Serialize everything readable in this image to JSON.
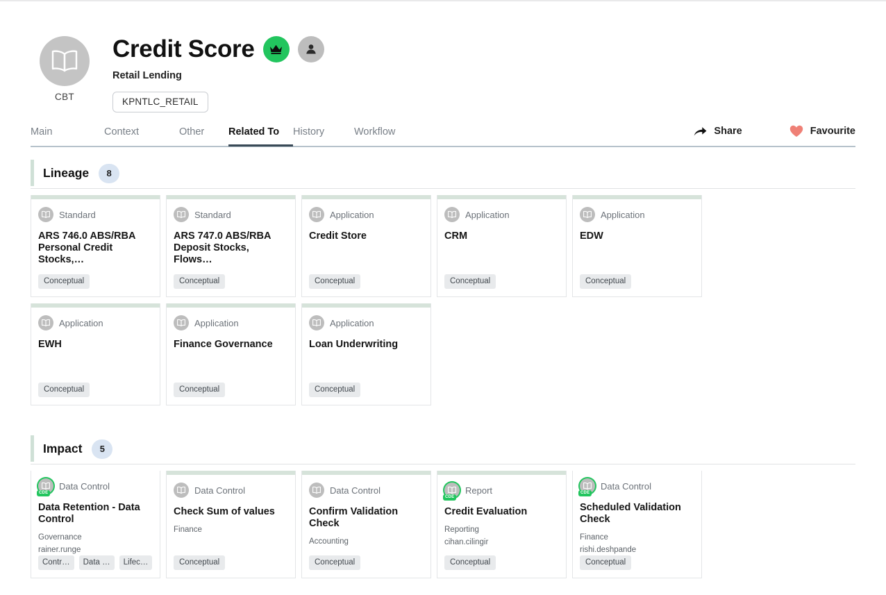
{
  "header": {
    "entity_code": "CBT",
    "entity_icon": "open-book-icon",
    "title": "Credit Score",
    "subtitle": "Retail Lending",
    "tag": "KPNTLC_RETAIL",
    "crown_badge_icon": "crown-icon",
    "crown_badge_color": "#22c55e",
    "user_badge_icon": "person-icon",
    "user_badge_color": "#bdbdbd"
  },
  "tabs": [
    {
      "label": "Main",
      "active": false
    },
    {
      "label": "Context",
      "active": false
    },
    {
      "label": "Other",
      "active": false
    },
    {
      "label": "Related To",
      "active": true
    },
    {
      "label": "History",
      "active": false
    },
    {
      "label": "Workflow",
      "active": false
    }
  ],
  "actions": [
    {
      "label": "Share",
      "icon": "share-arrow-icon",
      "color": "#1d1d1d"
    },
    {
      "label": "Favourite",
      "icon": "heart-icon",
      "color": "#ef8076"
    }
  ],
  "sections": [
    {
      "title": "Lineage",
      "count": "8",
      "accent_color": "#cfe0d6",
      "cards": [
        {
          "type": "Standard",
          "name": "ARS 746.0 ABS/RBA Personal Credit Stocks,…",
          "meta1": "",
          "meta2": "",
          "chips": [
            "Conceptual"
          ],
          "cde": false
        },
        {
          "type": "Standard",
          "name": "ARS 747.0 ABS/RBA Deposit Stocks, Flows…",
          "meta1": "",
          "meta2": "",
          "chips": [
            "Conceptual"
          ],
          "cde": false
        },
        {
          "type": "Application",
          "name": "Credit Store",
          "meta1": "",
          "meta2": "",
          "chips": [
            "Conceptual"
          ],
          "cde": false
        },
        {
          "type": "Application",
          "name": "CRM",
          "meta1": "",
          "meta2": "",
          "chips": [
            "Conceptual"
          ],
          "cde": false
        },
        {
          "type": "Application",
          "name": "EDW",
          "meta1": "",
          "meta2": "",
          "chips": [
            "Conceptual"
          ],
          "cde": false
        },
        {
          "type": "Application",
          "name": "EWH",
          "meta1": "",
          "meta2": "",
          "chips": [
            "Conceptual"
          ],
          "cde": false
        },
        {
          "type": "Application",
          "name": "Finance Governance",
          "meta1": "",
          "meta2": "",
          "chips": [
            "Conceptual"
          ],
          "cde": false
        },
        {
          "type": "Application",
          "name": "Loan Underwriting",
          "meta1": "",
          "meta2": "",
          "chips": [
            "Conceptual"
          ],
          "cde": false
        }
      ]
    },
    {
      "title": "Impact",
      "count": "5",
      "accent_color": "#cfe0d6",
      "cards": [
        {
          "type": "Data Control",
          "name": "Data Retention - Data Control",
          "meta1": "Governance",
          "meta2": "rainer.runge",
          "chips": [
            "Contr…",
            "Data …",
            "Lifec…"
          ],
          "cde": true
        },
        {
          "type": "Data Control",
          "name": "Check Sum of values",
          "meta1": "Finance",
          "meta2": "",
          "chips": [
            "Conceptual"
          ],
          "cde": false
        },
        {
          "type": "Data Control",
          "name": "Confirm Validation Check",
          "meta1": "Accounting",
          "meta2": "",
          "chips": [
            "Conceptual"
          ],
          "cde": false
        },
        {
          "type": "Report",
          "name": "Credit Evaluation",
          "meta1": "Reporting",
          "meta2": "cihan.cilingir",
          "chips": [
            "Conceptual"
          ],
          "cde": true
        },
        {
          "type": "Data Control",
          "name": "Scheduled Validation Check",
          "meta1": "Finance",
          "meta2": "rishi.deshpande",
          "chips": [
            "Conceptual"
          ],
          "cde": true
        }
      ]
    }
  ],
  "cde_label": "CDE"
}
